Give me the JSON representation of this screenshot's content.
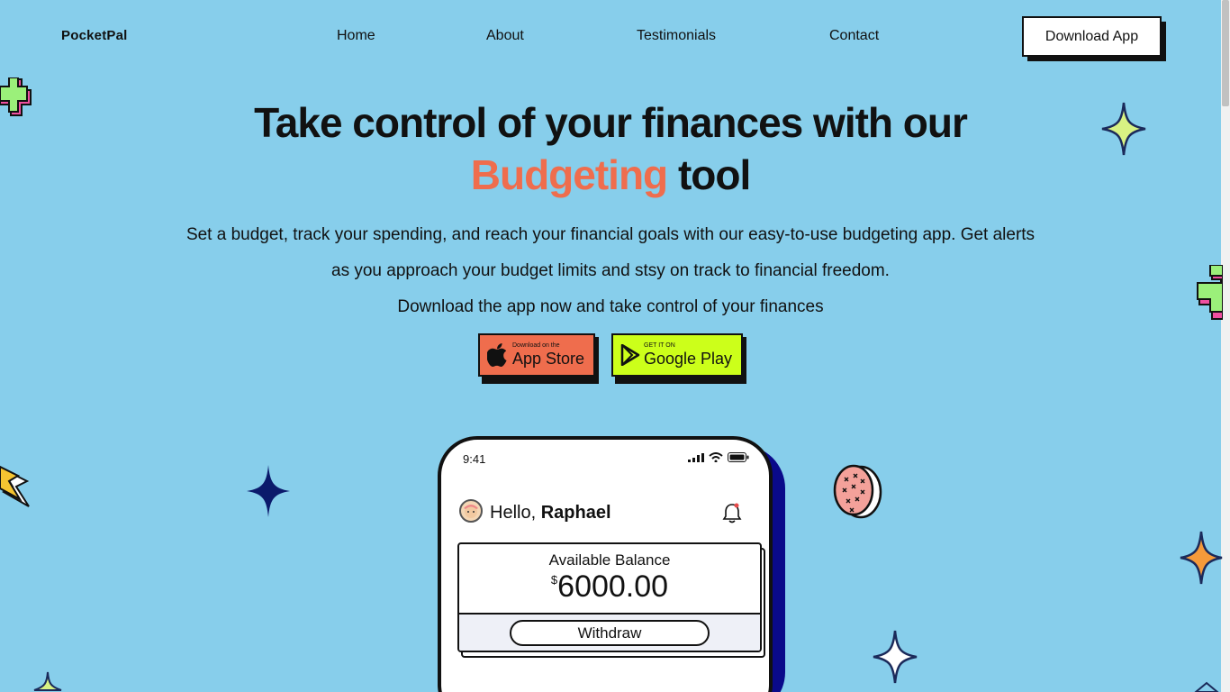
{
  "nav": {
    "logo": "PocketPal",
    "links": [
      "Home",
      "About",
      "Testimonials",
      "Contact"
    ],
    "cta": "Download App"
  },
  "hero": {
    "title_line1": "Take control of your finances with our",
    "title_accent": "Budgeting",
    "title_end": "tool",
    "description_line1": "Set a budget, track your spending, and reach your financial goals with our easy-to-use budgeting app. Get alerts",
    "description_line2": "as you approach your budget limits and stsy on track to financial freedom.",
    "description_line3": "Download the app now and take control of your finances"
  },
  "stores": {
    "apple": {
      "small": "Download on the",
      "big": "App Store",
      "color": "#EF6D4D"
    },
    "google": {
      "small": "GET IT ON",
      "big": "Google Play",
      "color": "#CCFF1A"
    }
  },
  "phone": {
    "time": "9:41",
    "greeting": "Hello,",
    "user": "Raphael",
    "balance_label": "Available Balance",
    "currency": "$",
    "balance": "6000.00",
    "withdraw": "Withdraw"
  },
  "colors": {
    "background": "#87CEEB",
    "accent": "#EF6D4D",
    "lime": "#CCFF1A",
    "phone_shadow": "#0a0a8a"
  }
}
